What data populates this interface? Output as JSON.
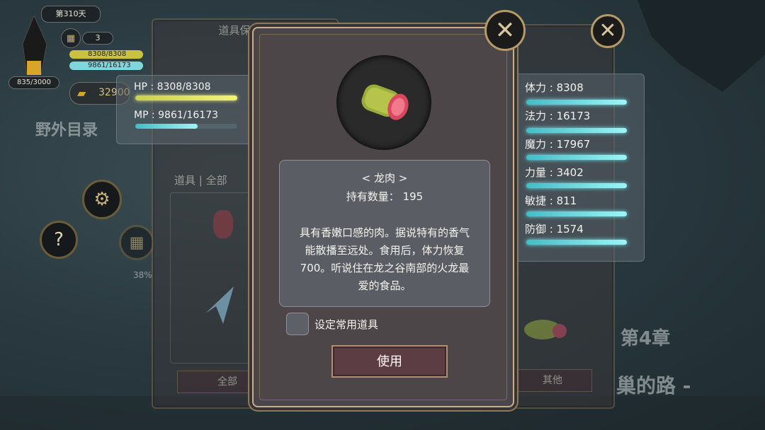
{
  "hud": {
    "day": "第310天",
    "calendar_count": "3",
    "hp_short": "8308/8308",
    "mp_short": "9861/16173",
    "exp": "835/3000",
    "gold": "32900",
    "percent": "38%"
  },
  "background": {
    "menu_label": "野外目录",
    "chapter": "第4章",
    "road_text": "巢的路 -"
  },
  "left_panel": {
    "title": "道具保管箱",
    "subtitle": "道具 | 全部",
    "tab_all": "全部"
  },
  "hpmp": {
    "hp_label": "HP : 8308/8308",
    "mp_label": "MP : 9861/16173",
    "hp_fill": 1.0,
    "mp_fill": 0.61
  },
  "stats": [
    {
      "label": "体力 : 8308"
    },
    {
      "label": "法力 : 16173"
    },
    {
      "label": "魔力 : 17967"
    },
    {
      "label": "力量 : 3402"
    },
    {
      "label": "敏捷 : 811"
    },
    {
      "label": "防御 : 1574"
    }
  ],
  "right_panel": {
    "tab_other": "其他"
  },
  "item_dialog": {
    "name": "< 龙肉 >",
    "quantity_label": "持有数量： 195",
    "description": "具有香嫩口感的肉。据说特有的香气能散播至远处。食用后，体力恢复700。听说住在龙之谷南部的火龙最爱的食品。",
    "checkbox_label": "设定常用道具",
    "checkbox_checked": false,
    "use_button": "使用"
  },
  "colors": {
    "frame_gold": "#c6b08a",
    "stat_bar": "#6fe8ee",
    "button_bg": "#5b3d43"
  }
}
